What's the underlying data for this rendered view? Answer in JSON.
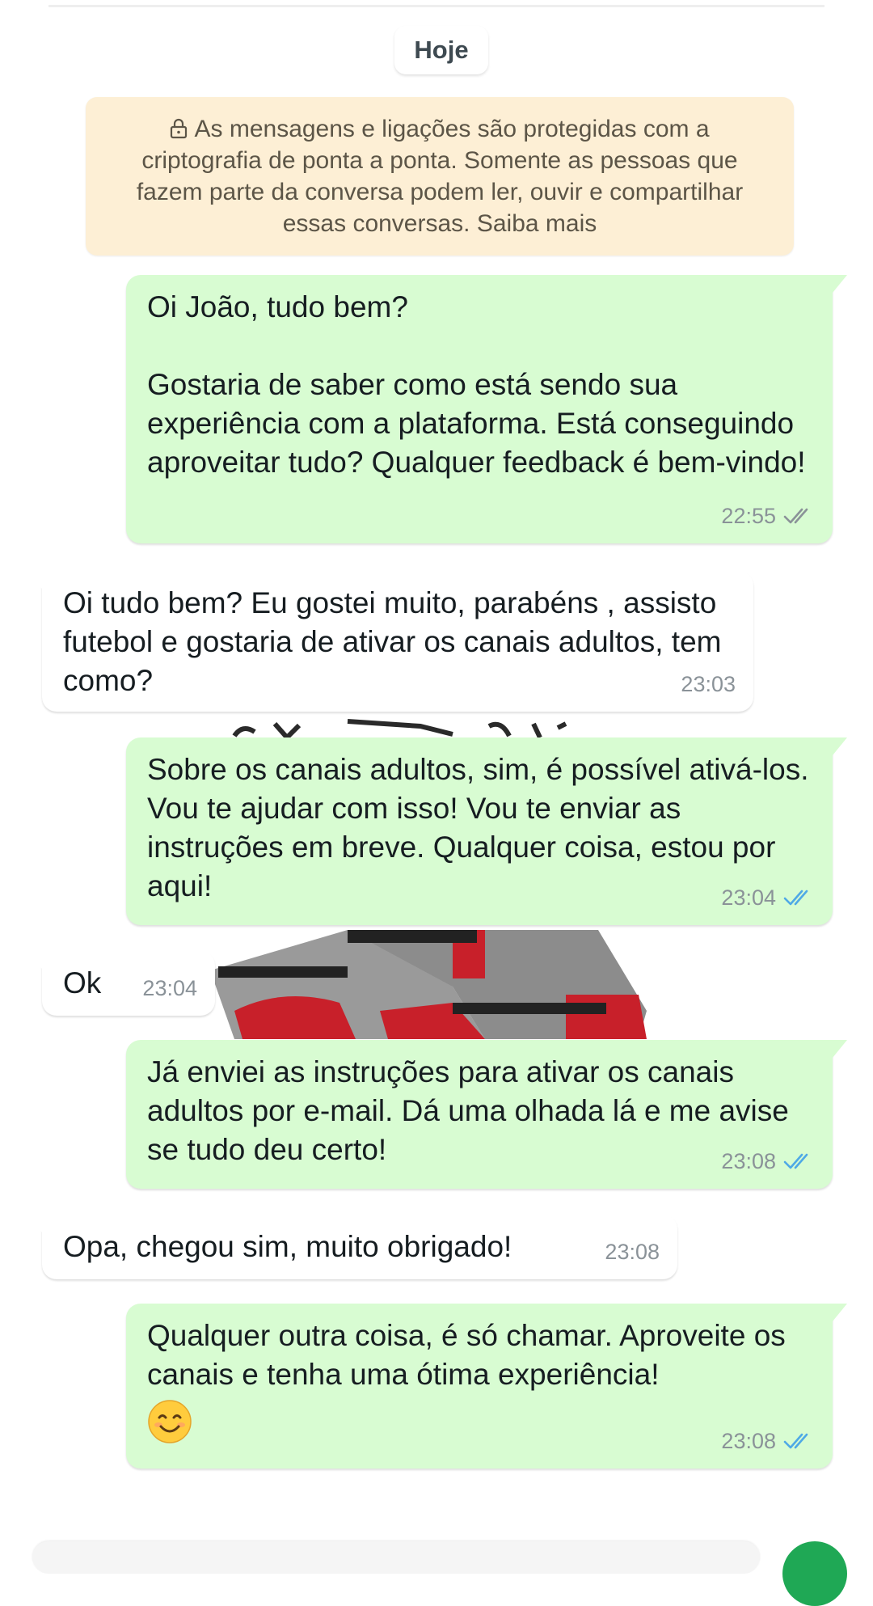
{
  "date_chip": "Hoje",
  "encryption_notice": "As mensagens e ligações são protegidas com a criptografia de ponta a ponta. Somente as pessoas que fazem parte da conversa podem ler, ouvir e compartilhar essas conversas. Saiba mais",
  "messages": [
    {
      "direction": "outgoing",
      "text": "Oi João, tudo bem?\n\nGostaria de saber como está sendo sua experiência com a plataforma. Está conseguindo aproveitar tudo? Qualquer feedback é bem-vindo!",
      "time": "22:55",
      "status": "delivered"
    },
    {
      "direction": "incoming",
      "text": "Oi tudo bem? Eu gostei muito, parabéns , assisto futebol e gostaria de ativar os canais adultos, tem como?",
      "time": "23:03"
    },
    {
      "direction": "outgoing",
      "text": "Sobre os canais adultos, sim, é possível ativá-los. Vou te ajudar com isso! Vou te enviar as instruções em breve. Qualquer coisa, estou por aqui!",
      "time": "23:04",
      "status": "read"
    },
    {
      "direction": "incoming",
      "text": "Ok",
      "time": "23:04"
    },
    {
      "direction": "outgoing",
      "text": "Já enviei as instruções para ativar os canais adultos por e-mail. Dá uma olhada lá e me avise se tudo deu certo!",
      "time": "23:08",
      "status": "read"
    },
    {
      "direction": "incoming",
      "text": "Opa, chegou sim, muito obrigado!",
      "time": "23:08"
    },
    {
      "direction": "outgoing",
      "text": "Qualquer outra coisa, é só chamar. Aproveite os canais e tenha uma ótima experiência!",
      "emoji": "smiling-face-emoji",
      "time": "23:08",
      "status": "read"
    }
  ],
  "colors": {
    "outgoing_bubble": "#d8fcd2",
    "incoming_bubble": "#ffffff",
    "notice_background": "#fdefd5",
    "read_ticks": "#4fa9e6",
    "delivered_ticks": "#8a9298"
  },
  "icons": {
    "notice": "lock-icon",
    "delivered": "double-check-gray-icon",
    "read": "double-check-blue-icon"
  }
}
